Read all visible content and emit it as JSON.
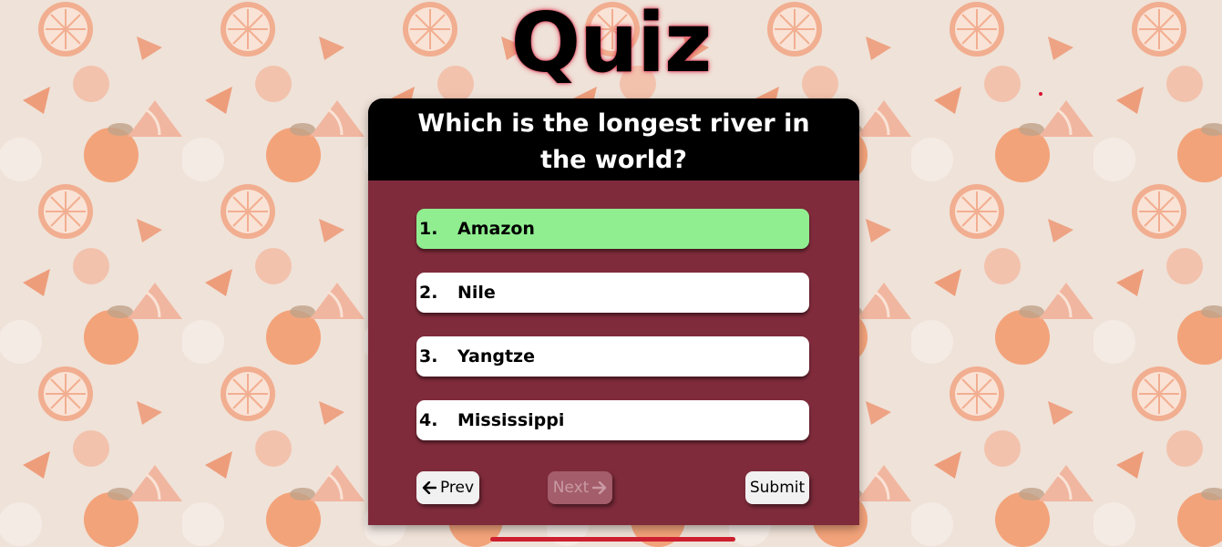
{
  "page": {
    "title": "Quiz"
  },
  "question": {
    "text": "Which is the longest river in the world?"
  },
  "options": [
    {
      "num": "1.",
      "label": "Amazon",
      "selected": true
    },
    {
      "num": "2.",
      "label": "Nile",
      "selected": false
    },
    {
      "num": "3.",
      "label": "Yangtze",
      "selected": false
    },
    {
      "num": "4.",
      "label": "Mississippi",
      "selected": false
    }
  ],
  "nav": {
    "prev_label": "Prev",
    "next_label": "Next",
    "submit_label": "Submit",
    "next_disabled": true
  },
  "colors": {
    "card": "#7f2b3b",
    "header": "#000000",
    "selected": "#90ee90",
    "option": "#ffffff",
    "glow": "#d9334f",
    "scroll_indicator": "#cc1f2f"
  },
  "icons": {
    "prev": "arrow-left-icon",
    "next": "arrow-right-icon"
  }
}
